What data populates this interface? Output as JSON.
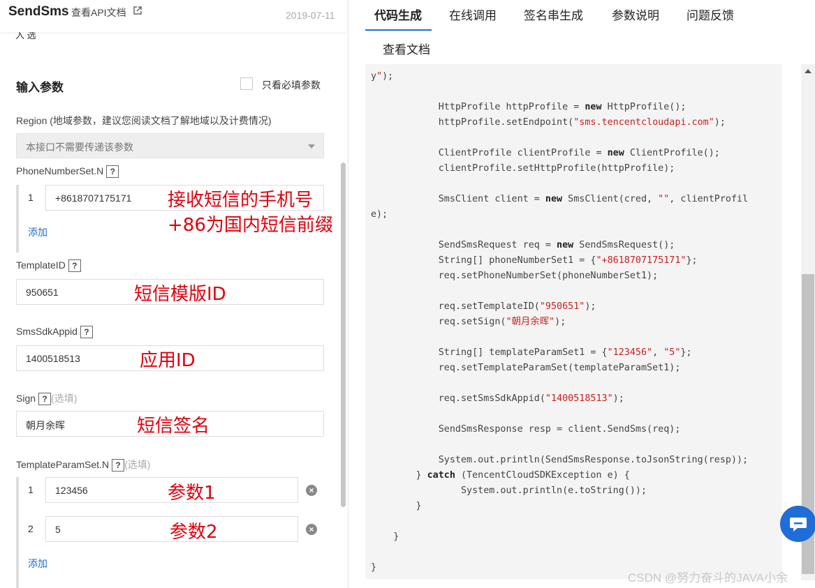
{
  "header": {
    "api_name": "SendSms",
    "doc_link": "查看API文档",
    "date": "2019-07-11",
    "cut_text": "入 选"
  },
  "params": {
    "section_title": "输入参数",
    "required_only_label": "只看必填参数",
    "region": {
      "label": "Region (地域参数，建议您阅读文档了解地域以及计费情况)",
      "select_value": "本接口不需要传递该参数"
    },
    "phone": {
      "label": "PhoneNumberSet.N",
      "items": [
        {
          "index": "1",
          "value": "+8618707175171"
        }
      ],
      "add": "添加",
      "anno_line1": "接收短信的手机号",
      "anno_line2": "+86为国内短信前缀"
    },
    "template_id": {
      "label": "TemplateID",
      "value": "950651",
      "anno": "短信模版ID"
    },
    "sdk_appid": {
      "label": "SmsSdkAppid",
      "value": "1400518513",
      "anno": "应用ID"
    },
    "sign": {
      "label": "Sign",
      "optional": "(选填)",
      "value": "朝月余晖",
      "anno": "短信签名"
    },
    "template_params": {
      "label": "TemplateParamSet.N",
      "optional": "(选填)",
      "items": [
        {
          "index": "1",
          "value": "123456",
          "anno": "参数1"
        },
        {
          "index": "2",
          "value": "5",
          "anno": "参数2"
        }
      ],
      "add": "添加"
    },
    "help_glyph": "?",
    "remove_glyph": "×"
  },
  "tabs": [
    "代码生成",
    "在线调用",
    "签名串生成",
    "参数说明",
    "问题反馈",
    "查看文档"
  ],
  "active_tab": "代码生成",
  "watermark": "CSDN @努力奋斗的JAVA小余",
  "code_lines": [
    "y\");",
    "",
    "            HttpProfile httpProfile = new HttpProfile();",
    "            httpProfile.setEndpoint(\"sms.tencentcloudapi.com\");",
    "",
    "            ClientProfile clientProfile = new ClientProfile();",
    "            clientProfile.setHttpProfile(httpProfile);",
    "",
    "            SmsClient client = new SmsClient(cred, \"\", clientProfil",
    "e);",
    "",
    "            SendSmsRequest req = new SendSmsRequest();",
    "            String[] phoneNumberSet1 = {\"+8618707175171\"};",
    "            req.setPhoneNumberSet(phoneNumberSet1);",
    "",
    "            req.setTemplateID(\"950651\");",
    "            req.setSign(\"朝月余晖\");",
    "",
    "            String[] templateParamSet1 = {\"123456\", \"5\"};",
    "            req.setTemplateParamSet(templateParamSet1);",
    "",
    "            req.setSmsSdkAppid(\"1400518513\");",
    "",
    "            SendSmsResponse resp = client.SendSms(req);",
    "",
    "            System.out.println(SendSmsResponse.toJsonString(resp));",
    "        } catch (TencentCloudSDKException e) {",
    "                System.out.println(e.toString());",
    "        }",
    "",
    "    }",
    "",
    "}"
  ],
  "colors": {
    "accent": "#1e6dd8",
    "annotation": "#e0000c",
    "code_bg": "#f4f4f4"
  }
}
